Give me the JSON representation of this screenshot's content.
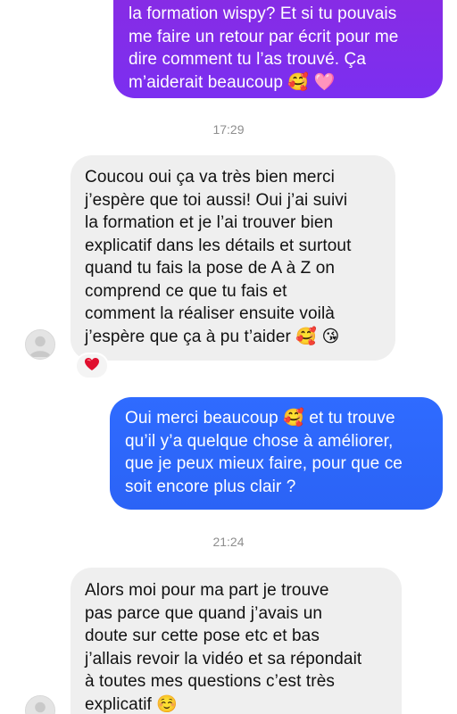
{
  "messages": [
    {
      "direction": "outgoing",
      "text": "la formation wispy? Et si tu pouvais\nme faire un retour par écrit pour me\ndire comment tu l’as trouvé. Ça\nm’aiderait beaucoup 🥰 🩷"
    },
    {
      "direction": "incoming",
      "text": "Coucou oui ça va très bien merci\nj’espère que toi aussi! Oui j’ai suivi\nla formation et je l’ai trouver bien\nexplicatif dans les détails et surtout\nquand tu fais la pose de A à Z on\ncomprend ce que tu fais et\ncomment la réaliser ensuite voilà\nj’espère que ça à pu t’aider 🥰 😘",
      "reaction": "❤️"
    },
    {
      "direction": "outgoing",
      "text": "Oui merci beaucoup 🥰  et tu trouve\nqu’il y’a quelque chose à améliorer,\nque je peux mieux faire, pour que ce\nsoit encore plus clair ?"
    },
    {
      "direction": "incoming",
      "text": "Alors moi pour ma part je trouve\npas parce que quand j’avais un\ndoute sur cette pose etc et bas\nj’allais revoir la vidéo et sa répondait\nà toutes mes questions c’est très\nexplicatif ☺️"
    }
  ],
  "timestamps": [
    "17:29",
    "21:24"
  ],
  "icons": {
    "avatar": "default-avatar-icon",
    "reaction": "heart-icon"
  },
  "colors": {
    "outgoing_gradient_top": "#8a2be2",
    "outgoing_blue": "#2f6bff",
    "incoming_bg": "#efefef",
    "timestamp": "#8e8e8e"
  }
}
